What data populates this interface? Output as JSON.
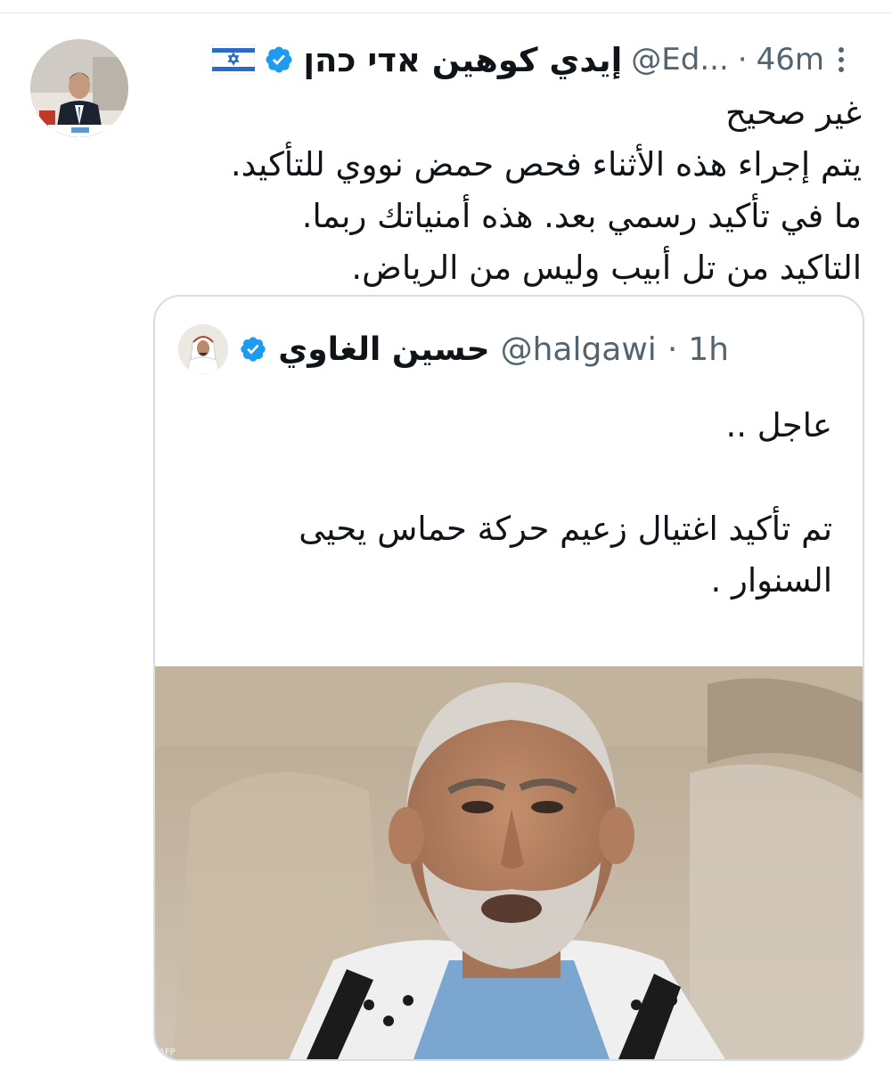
{
  "tweet": {
    "author_name": "إيدي كوهين אדי כהן",
    "flag_icon": "israel-flag-icon",
    "verified_icon": "verified-badge-icon",
    "handle": "@Ed...",
    "separator": "·",
    "time": "46m",
    "text_lines": [
      "غير صحيح",
      "يتم إجراء هذه الأثناء فحص حمض نووي للتأكيد.",
      "ما في تأكيد رسمي بعد. هذه أمنياتك ربما.",
      "التاكيد من تل أبيب وليس من الرياض."
    ]
  },
  "quoted": {
    "author_name": "حسين الغاوي",
    "verified_icon": "verified-badge-icon",
    "handle": "@halgawi",
    "separator": "·",
    "time": "1h",
    "paragraphs": [
      "عاجل ..",
      "تم تأكيد اغتيال زعيم حركة حماس يحيى السنوار ."
    ],
    "ellipsis": "...",
    "image_credit": "AFP"
  },
  "colors": {
    "verified_blue": "#1d9bf0",
    "secondary_text": "#536471",
    "border": "#d7dde2"
  }
}
